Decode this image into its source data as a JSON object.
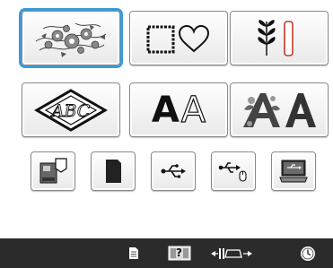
{
  "pattern_menu": {
    "row1": [
      {
        "icon": "floral-embroidery-icon"
      },
      {
        "icon": "frame-shapes-icon"
      },
      {
        "icon": "utility-stitch-icon"
      }
    ],
    "row2": [
      {
        "icon": "monogram-diamond-icon",
        "text": "ABC"
      },
      {
        "icon": "alphabet-letters-icon",
        "text_solid": "A",
        "text_outline": "A"
      },
      {
        "icon": "decorative-alphabet-icon"
      }
    ],
    "row3": [
      {
        "icon": "embroidery-machine-memory-icon"
      },
      {
        "icon": "sd-card-icon"
      },
      {
        "icon": "usb-icon"
      },
      {
        "icon": "usb-mouse-icon"
      },
      {
        "icon": "computer-usb-icon"
      }
    ]
  },
  "bottom_bar": {
    "items": [
      {
        "icon": "page-icon"
      },
      {
        "icon": "help-icon",
        "text": "?"
      },
      {
        "icon": "frame-size-icon"
      },
      {
        "icon": "clock-icon"
      }
    ]
  },
  "colors": {
    "selection": "#3a9ad9",
    "bottom_bar": "#2b2b2b"
  }
}
